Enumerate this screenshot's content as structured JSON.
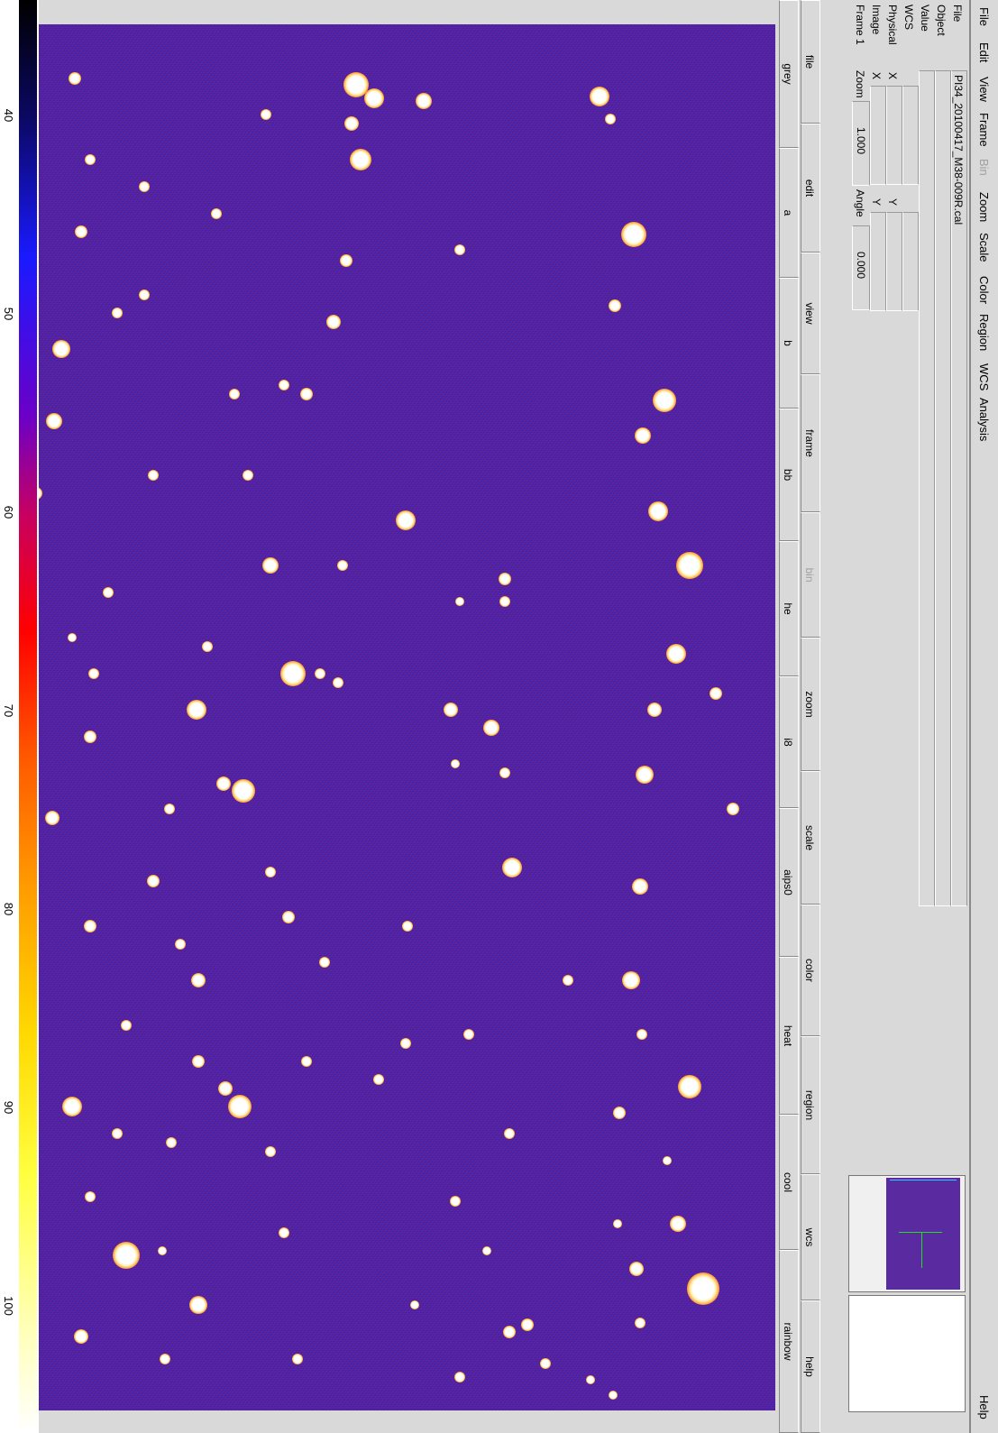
{
  "menu": [
    "File",
    "Edit",
    "View",
    "Frame",
    "Bin",
    "Zoom",
    "Scale",
    "Color",
    "Region",
    "WCS",
    "Analysis"
  ],
  "menu_help": "Help",
  "info": {
    "file_label": "File",
    "file_value": "PI34_20100417_M38-009R.cal",
    "object_label": "Object",
    "value_label": "Value",
    "wcs_label": "WCS",
    "physical_label": "Physical",
    "image_label": "Image",
    "frame_label": "Frame 1",
    "x_label": "X",
    "y_label": "Y",
    "zoom_label": "Zoom",
    "zoom_value": "1.000",
    "angle_label": "Angle",
    "angle_value": "0.000"
  },
  "buttons_main": [
    "file",
    "edit",
    "view",
    "frame",
    "bin",
    "zoom",
    "scale",
    "color",
    "region",
    "wcs",
    "help"
  ],
  "buttons_color": [
    "grey",
    "a",
    "b",
    "bb",
    "he",
    "i8",
    "aips0",
    "heat",
    "cool",
    "rainbow"
  ],
  "colorbar_ticks": [
    "40",
    "50",
    "60",
    "70",
    "80",
    "90",
    "100"
  ],
  "colors": {
    "background_purple": "#5a2aa0",
    "panel": "#d9d9d9"
  }
}
